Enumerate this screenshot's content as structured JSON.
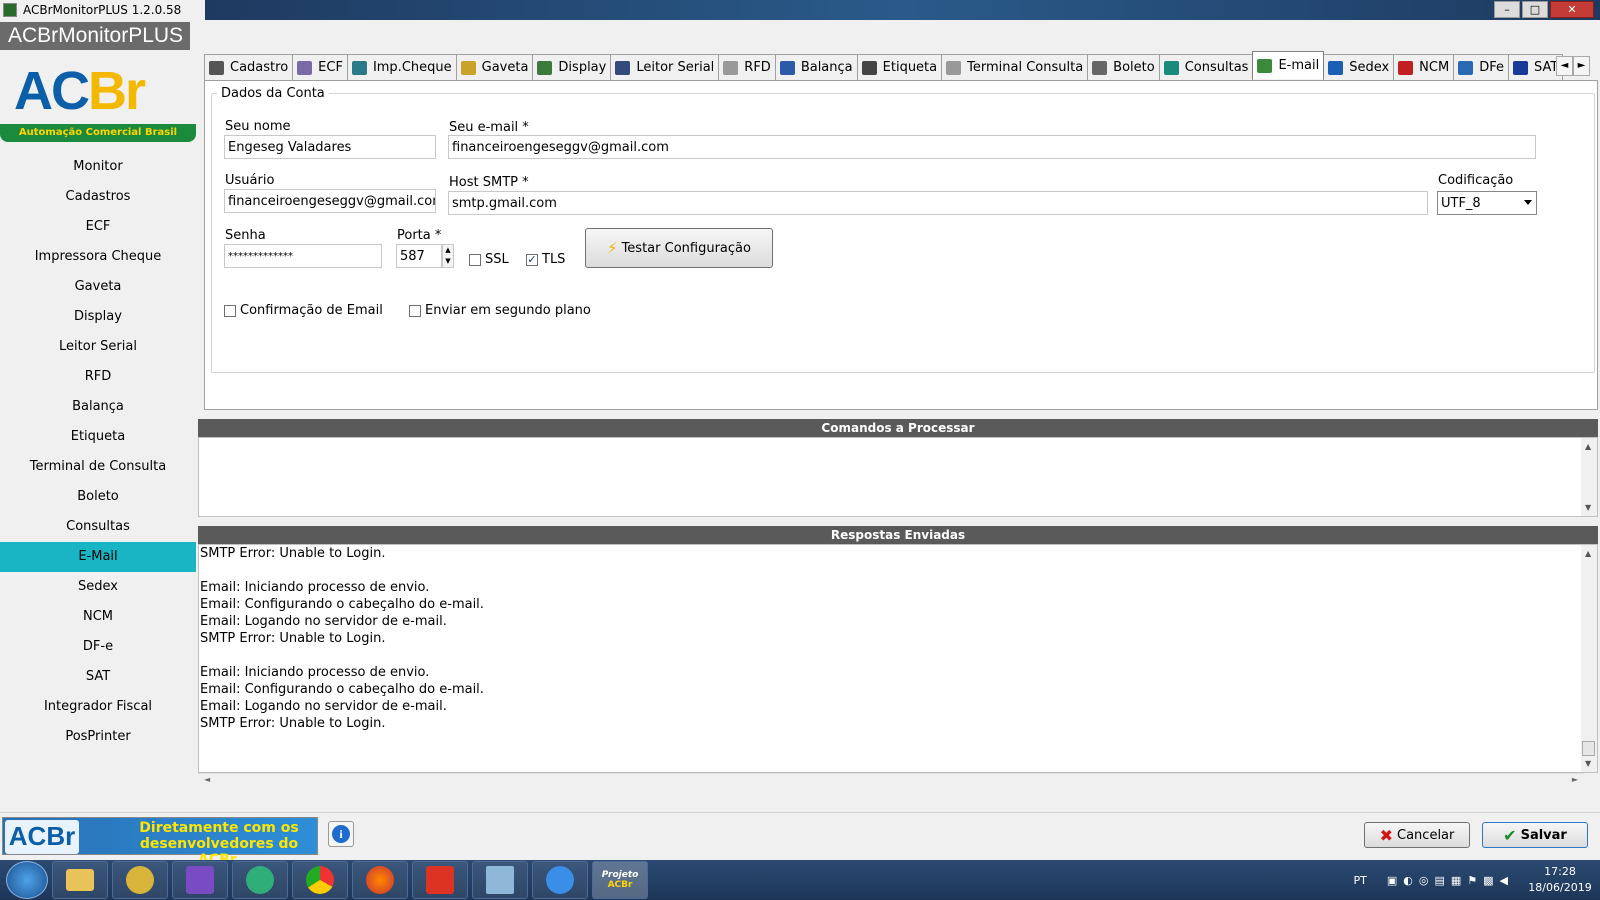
{
  "window": {
    "title": "ACBrMonitorPLUS 1.2.0.58",
    "app_header": "ACBrMonitorPLUS",
    "min": "–",
    "max": "□",
    "close": "✕"
  },
  "logo": {
    "text": "AC",
    "text2": "Br",
    "ribbon": "Automação Comercial Brasil"
  },
  "sidebar": {
    "items": [
      "Monitor",
      "Cadastros",
      "ECF",
      "Impressora Cheque",
      "Gaveta",
      "Display",
      "Leitor Serial",
      "RFD",
      "Balança",
      "Etiqueta",
      "Terminal de Consulta",
      "Boleto",
      "Consultas",
      "E-Mail",
      "Sedex",
      "NCM",
      "DF-e",
      "SAT",
      "Integrador Fiscal",
      "PosPrinter"
    ],
    "active": "E-Mail"
  },
  "tabs": [
    {
      "label": "Cadastro",
      "color": "#555"
    },
    {
      "label": "ECF",
      "color": "#7a6aa8"
    },
    {
      "label": "Imp.Cheque",
      "color": "#2a7a8a"
    },
    {
      "label": "Gaveta",
      "color": "#c9a227"
    },
    {
      "label": "Display",
      "color": "#3b7a3b"
    },
    {
      "label": "Leitor Serial",
      "color": "#334a7a"
    },
    {
      "label": "RFD",
      "color": "#999"
    },
    {
      "label": "Balança",
      "color": "#2a5aa8"
    },
    {
      "label": "Etiqueta",
      "color": "#444"
    },
    {
      "label": "Terminal Consulta",
      "color": "#999"
    },
    {
      "label": "Boleto",
      "color": "#666"
    },
    {
      "label": "Consultas",
      "color": "#1a8a7a"
    },
    {
      "label": "E-mail",
      "color": "#3a8a3a"
    },
    {
      "label": "Sedex",
      "color": "#1a5fb4"
    },
    {
      "label": "NCM",
      "color": "#c02020"
    },
    {
      "label": "DFe",
      "color": "#2a6ab4"
    },
    {
      "label": "SAT",
      "color": "#1a3a9a"
    }
  ],
  "tab_scroll": {
    "left": "◄",
    "right": "►"
  },
  "form": {
    "group_title": "Dados da Conta",
    "nome_label": "Seu nome",
    "nome_value": "Engeseg Valadares",
    "email_label": "Seu e-mail *",
    "email_value": "financeiroengeseggv@gmail.com",
    "usuario_label": "Usuário",
    "usuario_value": "financeiroengeseggv@gmail.com",
    "host_label": "Host SMTP *",
    "host_value": "smtp.gmail.com",
    "cod_label": "Codificação",
    "cod_value": "UTF_8",
    "senha_label": "Senha",
    "senha_value": "*************",
    "porta_label": "Porta *",
    "porta_value": "587",
    "ssl_label": "SSL",
    "ssl_checked": false,
    "tls_label": "TLS",
    "tls_checked": true,
    "testar_label": "Testar Configuração",
    "confirm_label": "Confirmação de Email",
    "segundo_label": "Enviar em segundo plano"
  },
  "comandos_title": "Comandos a Processar",
  "respostas_title": "Respostas Enviadas",
  "respostas": [
    "SMTP Error: Unable to Login.",
    "",
    "Email: Iniciando processo de envio.",
    "Email: Configurando o cabeçalho do e-mail.",
    "Email: Logando no servidor de e-mail.",
    "SMTP Error: Unable to Login.",
    "",
    "Email: Iniciando processo de envio.",
    "Email: Configurando o cabeçalho do e-mail.",
    "Email: Logando no servidor de e-mail.",
    "SMTP Error: Unable to Login."
  ],
  "banner": {
    "logo": "ACBr",
    "line1": "Diretamente com os",
    "line2": "desenvolvedores do ACBr."
  },
  "buttons": {
    "cancelar": "Cancelar",
    "salvar": "Salvar"
  },
  "taskbar": {
    "lang": "PT",
    "time": "17:28",
    "date": "18/06/2019",
    "project_label": "Projeto"
  }
}
